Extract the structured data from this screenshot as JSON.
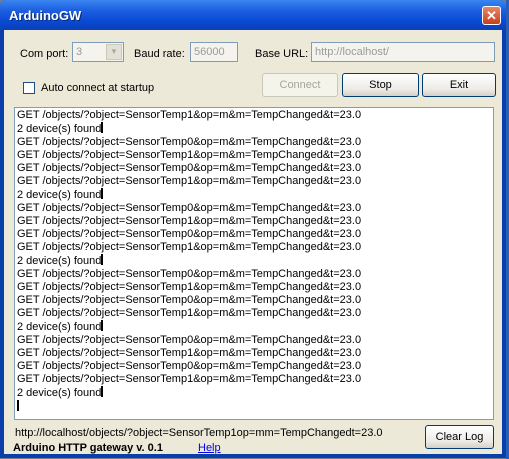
{
  "window": {
    "title": "ArduinoGW",
    "close_glyph": "✕",
    "close_icon": "close-icon"
  },
  "settings": {
    "com_port_label": "Com port:",
    "com_port_value": "3",
    "baud_rate_label": "Baud rate:",
    "baud_rate_value": "56000",
    "base_url_label": "Base URL:",
    "base_url_value": "http://localhost/",
    "auto_connect_label": "Auto connect at startup",
    "auto_connect_checked": false
  },
  "buttons": {
    "connect": "Connect",
    "stop": "Stop",
    "exit": "Exit",
    "clear_log": "Clear Log"
  },
  "log": {
    "lines": [
      "GET /objects/?object=SensorTemp1&op=m&m=TempChanged&t=23.0",
      "2 device(s) found",
      "GET /objects/?object=SensorTemp0&op=m&m=TempChanged&t=23.0",
      "GET /objects/?object=SensorTemp1&op=m&m=TempChanged&t=23.0",
      "GET /objects/?object=SensorTemp0&op=m&m=TempChanged&t=23.0",
      "GET /objects/?object=SensorTemp1&op=m&m=TempChanged&t=23.0",
      "2 device(s) found",
      "GET /objects/?object=SensorTemp0&op=m&m=TempChanged&t=23.0",
      "GET /objects/?object=SensorTemp1&op=m&m=TempChanged&t=23.0",
      "GET /objects/?object=SensorTemp0&op=m&m=TempChanged&t=23.0",
      "GET /objects/?object=SensorTemp1&op=m&m=TempChanged&t=23.0",
      "2 device(s) found",
      "GET /objects/?object=SensorTemp0&op=m&m=TempChanged&t=23.0",
      "GET /objects/?object=SensorTemp1&op=m&m=TempChanged&t=23.0",
      "GET /objects/?object=SensorTemp0&op=m&m=TempChanged&t=23.0",
      "GET /objects/?object=SensorTemp1&op=m&m=TempChanged&t=23.0",
      "2 device(s) found",
      "GET /objects/?object=SensorTemp0&op=m&m=TempChanged&t=23.0",
      "GET /objects/?object=SensorTemp1&op=m&m=TempChanged&t=23.0",
      "GET /objects/?object=SensorTemp0&op=m&m=TempChanged&t=23.0",
      "GET /objects/?object=SensorTemp1&op=m&m=TempChanged&t=23.0",
      "2 device(s) found",
      ""
    ]
  },
  "status": {
    "last_request": "http://localhost/objects/?object=SensorTemp1op=mm=TempChangedt=23.0"
  },
  "footer": {
    "app_name": "Arduino HTTP gateway v. 0.1",
    "help_link": "Help"
  },
  "colors": {
    "titlebar": "#0a4ad4",
    "dialog_bg": "#ece9d8",
    "link": "#0000ee"
  }
}
